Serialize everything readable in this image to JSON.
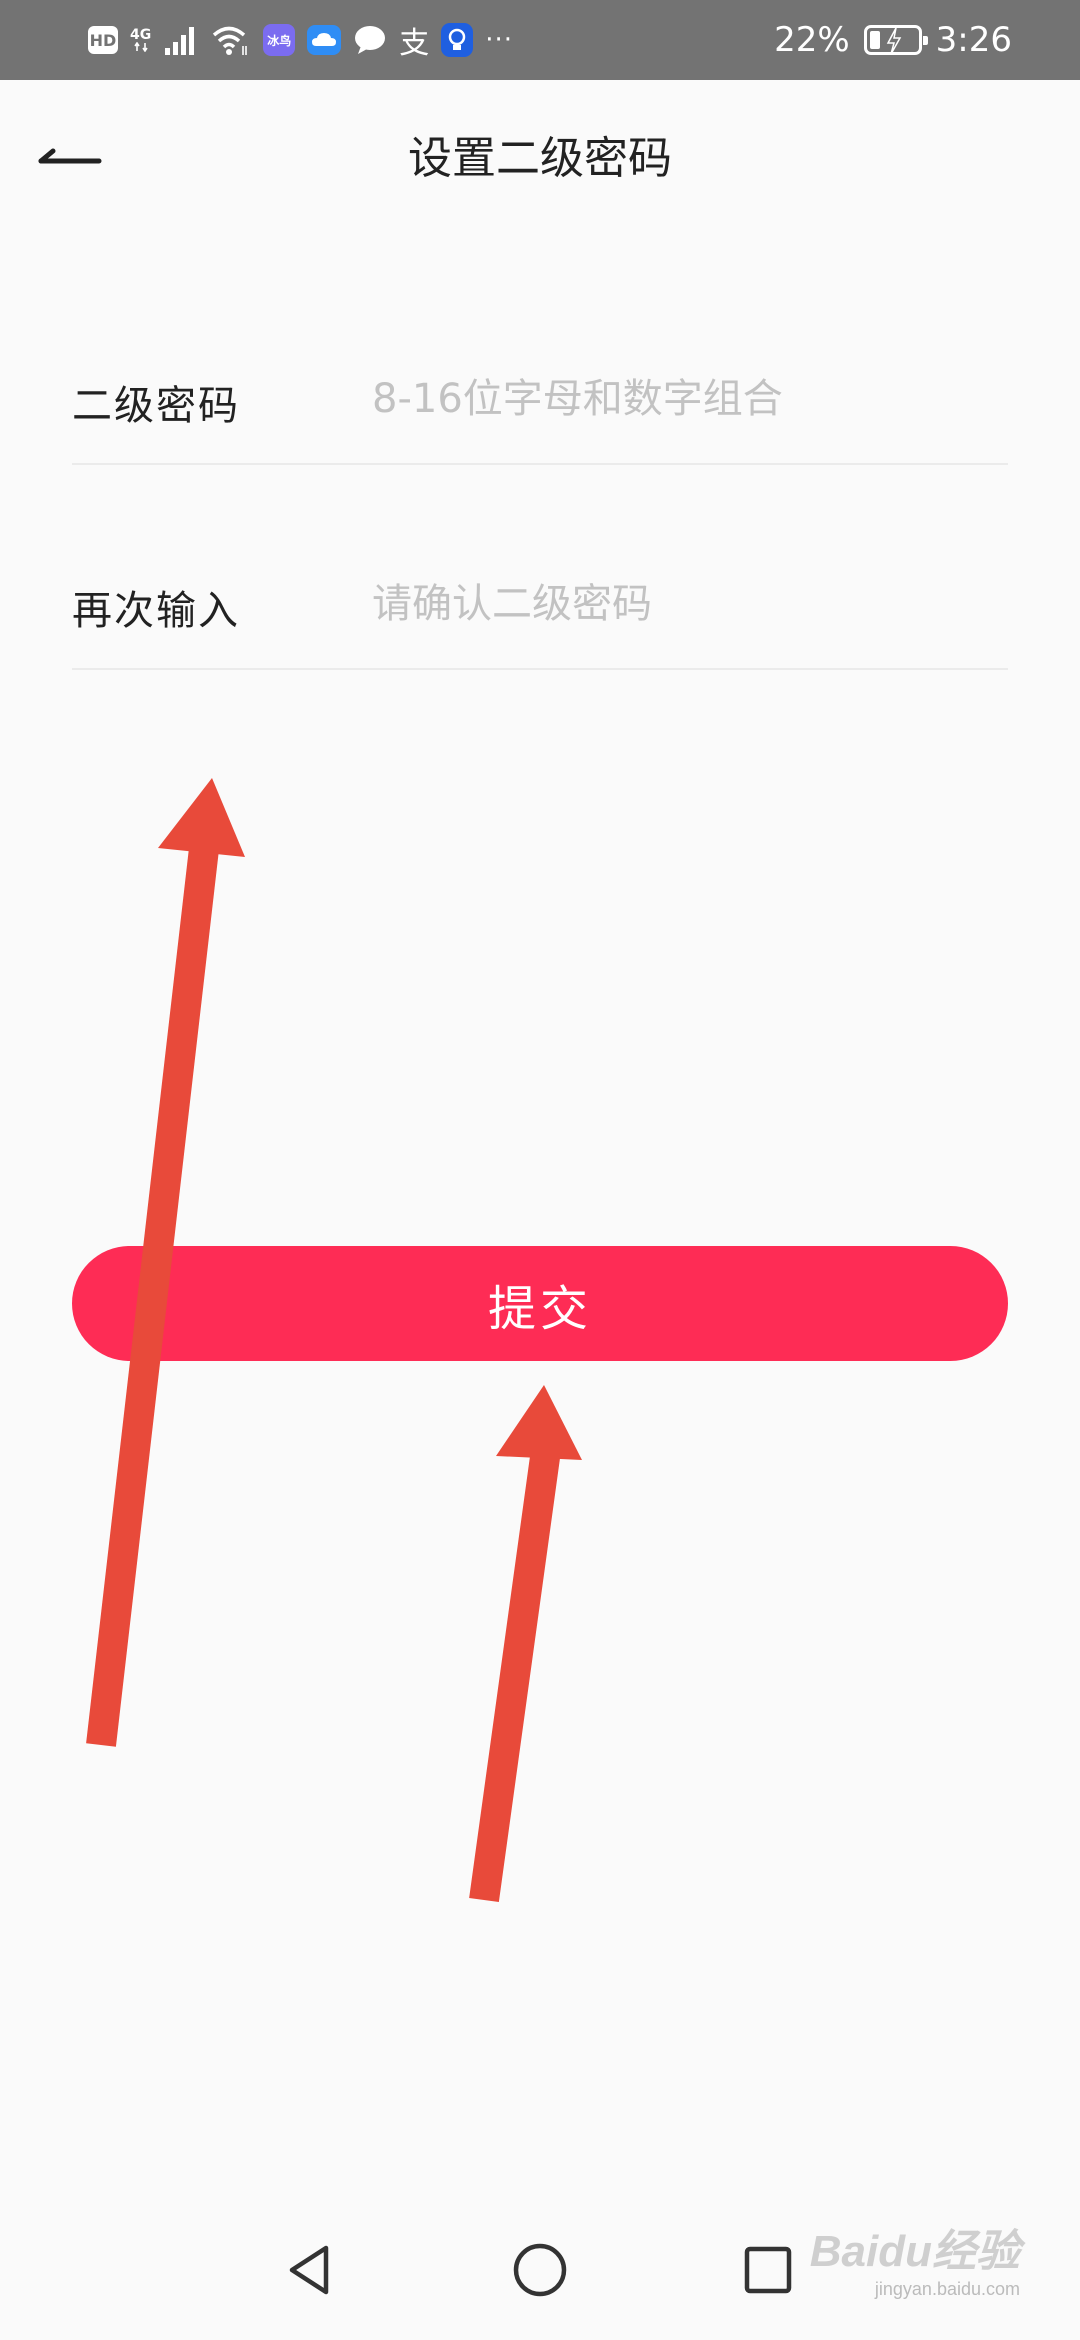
{
  "status_bar": {
    "hd_label": "HD",
    "network_type": "4G",
    "app_badge_text": "冰鸟",
    "alipay_glyph": "支",
    "more_indicator": "···",
    "battery_percent": "22%",
    "battery_level": 0.22,
    "time": "3:26"
  },
  "header": {
    "title": "设置二级密码"
  },
  "form": {
    "password": {
      "label": "二级密码",
      "placeholder": "8-16位字母和数字组合",
      "value": ""
    },
    "confirm": {
      "label": "再次输入",
      "placeholder": "请确认二级密码",
      "value": ""
    }
  },
  "submit": {
    "label": "提交"
  },
  "colors": {
    "accent": "#fe2c55",
    "annotation_arrow": "#e84a3a",
    "status_bar_bg": "#737373",
    "page_bg": "#fafafa"
  },
  "watermark": {
    "logo": "Baidu经验",
    "url": "jingyan.baidu.com"
  }
}
